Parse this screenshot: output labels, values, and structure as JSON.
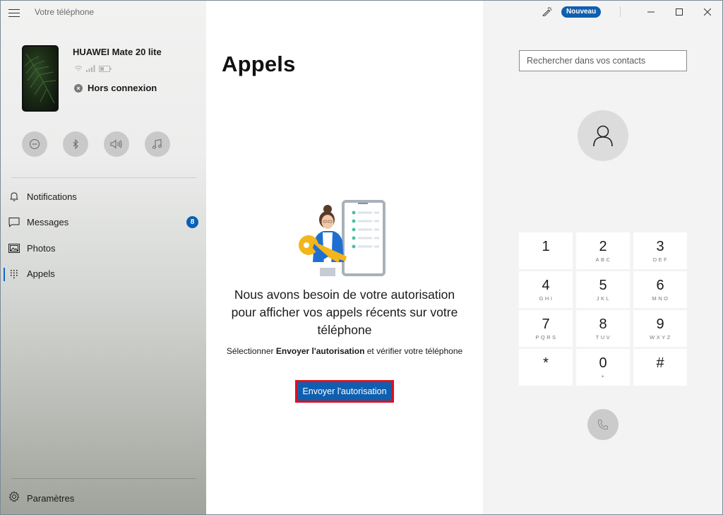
{
  "window": {
    "app_title": "Votre téléphone",
    "new_badge": "Nouveau",
    "controls": {
      "minimize": "minimize",
      "maximize": "maximize",
      "close": "close"
    }
  },
  "device": {
    "name": "HUAWEI Mate 20 lite",
    "status": "Hors connexion",
    "status_icons": [
      "wifi-icon",
      "signal-icon",
      "battery-icon"
    ]
  },
  "quick_actions": [
    {
      "name": "do-not-disturb",
      "icon": "minus-circle-icon"
    },
    {
      "name": "bluetooth",
      "icon": "bluetooth-icon"
    },
    {
      "name": "volume",
      "icon": "speaker-icon"
    },
    {
      "name": "music",
      "icon": "music-note-icon"
    }
  ],
  "sidebar": {
    "items": [
      {
        "label": "Notifications",
        "icon": "bell-icon",
        "badge": null,
        "active": false
      },
      {
        "label": "Messages",
        "icon": "chat-icon",
        "badge": "8",
        "active": false
      },
      {
        "label": "Photos",
        "icon": "image-icon",
        "badge": null,
        "active": false
      },
      {
        "label": "Appels",
        "icon": "dialpad-icon",
        "badge": null,
        "active": true
      }
    ],
    "settings_label": "Paramètres"
  },
  "main": {
    "title": "Appels",
    "permission_title": "Nous avons besoin de votre autorisation pour afficher vos appels récents sur votre téléphone",
    "permission_sub_prefix": "Sélectionner ",
    "permission_sub_bold": "Envoyer l'autorisation",
    "permission_sub_suffix": " et vérifier votre téléphone",
    "send_button": "Envoyer l'autorisation"
  },
  "dialer": {
    "search_placeholder": "Rechercher dans vos contacts",
    "keys": [
      {
        "num": "1",
        "letters": ""
      },
      {
        "num": "2",
        "letters": "ABC"
      },
      {
        "num": "3",
        "letters": "DEF"
      },
      {
        "num": "4",
        "letters": "GHI"
      },
      {
        "num": "5",
        "letters": "JKL"
      },
      {
        "num": "6",
        "letters": "MNO"
      },
      {
        "num": "7",
        "letters": "PQRS"
      },
      {
        "num": "8",
        "letters": "TUV"
      },
      {
        "num": "9",
        "letters": "WXYZ"
      },
      {
        "num": "*",
        "letters": ""
      },
      {
        "num": "0",
        "letters": "+"
      },
      {
        "num": "#",
        "letters": ""
      }
    ]
  },
  "colors": {
    "accent": "#0f5fb0",
    "badge": "#0a5fb4",
    "highlight_border": "#e0101c"
  }
}
